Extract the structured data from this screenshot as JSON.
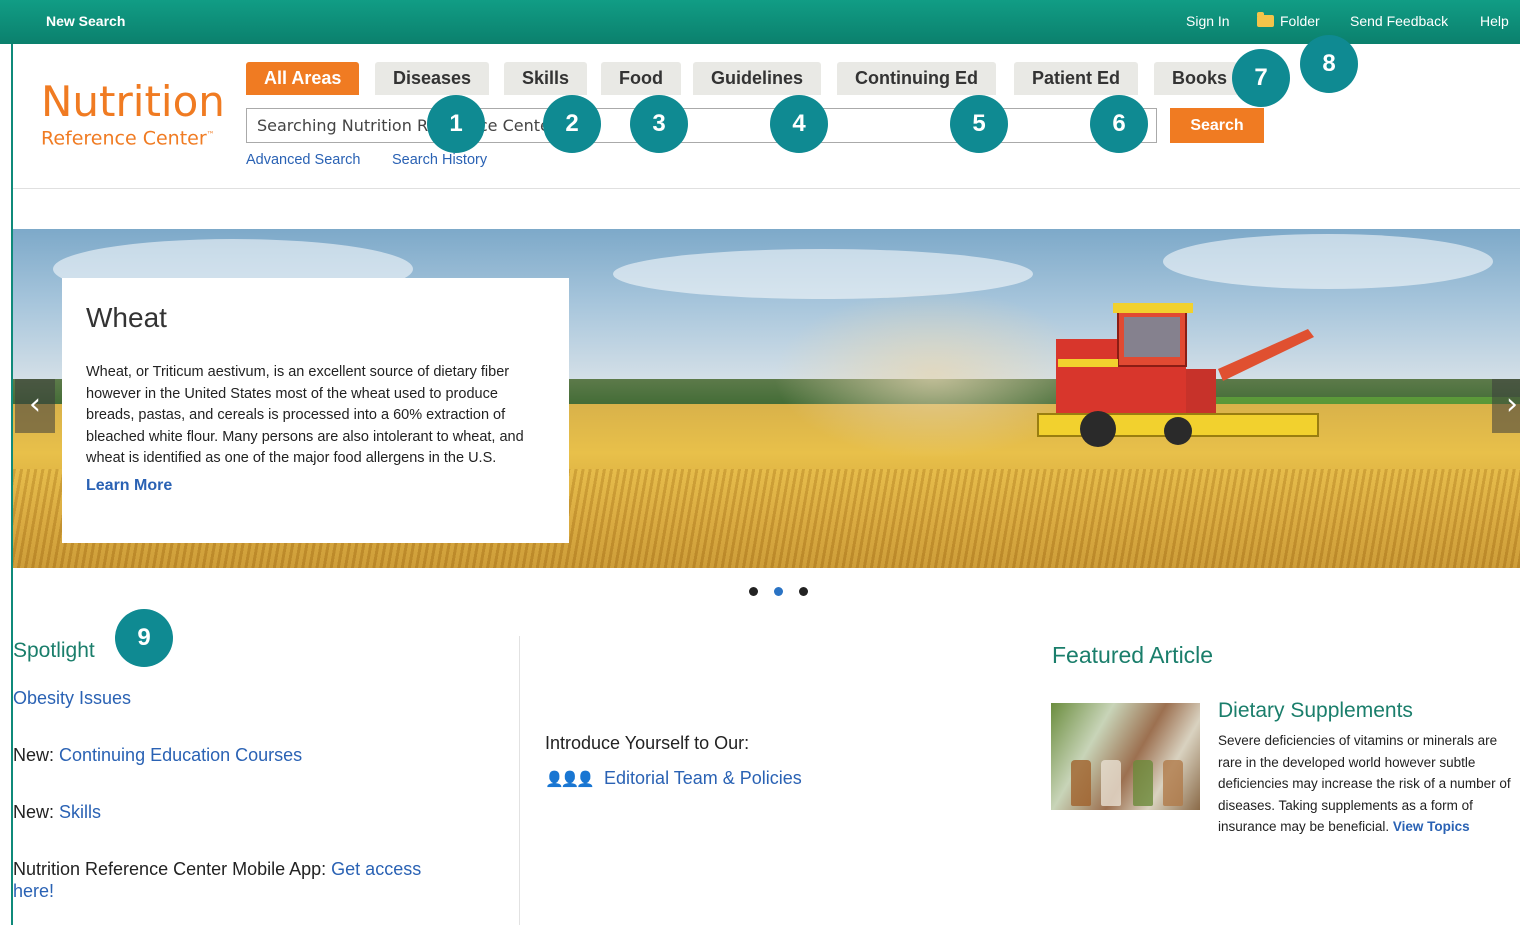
{
  "topbar": {
    "new_search": "New Search",
    "sign_in": "Sign In",
    "folder": "Folder",
    "send_feedback": "Send Feedback",
    "help": "Help"
  },
  "logo": {
    "main": "Nutrition",
    "sub": "Reference Center",
    "tm": "™"
  },
  "tabs": [
    {
      "label": "All Areas",
      "active": true
    },
    {
      "label": "Diseases"
    },
    {
      "label": "Skills"
    },
    {
      "label": "Food"
    },
    {
      "label": "Guidelines"
    },
    {
      "label": "Continuing Ed"
    },
    {
      "label": "Patient Ed"
    },
    {
      "label": "Books"
    }
  ],
  "search": {
    "value": "Searching Nutrition Reference Center",
    "button": "Search",
    "advanced": "Advanced Search",
    "history": "Search History"
  },
  "badges": [
    "1",
    "2",
    "3",
    "4",
    "5",
    "6",
    "7",
    "8",
    "9"
  ],
  "hero": {
    "title": "Wheat",
    "text": "Wheat, or Triticum aestivum, is an excellent source of dietary fiber however in the United States most of the wheat used to produce breads, pastas, and cereals is processed into a 60% extraction of bleached white flour. Many persons are also intolerant to wheat, and wheat is identified as one of the major food allergens in the U.S.",
    "learn_more": "Learn More",
    "prev": "‹",
    "next": "›",
    "slides": 3,
    "active_slide": 2
  },
  "spotlight": {
    "title": "Spotlight",
    "item1": "Obesity Issues",
    "item2_prefix": "New: ",
    "item2_link": "Continuing Education Courses",
    "item3_prefix": "New: ",
    "item3_link": "Skills",
    "item4_prefix": "Nutrition Reference Center Mobile App: ",
    "item4_link": "Get access here!"
  },
  "intro": {
    "text": "Introduce Yourself to Our:",
    "link": "Editorial Team & Policies"
  },
  "featured": {
    "title": "Featured Article",
    "headline": "Dietary Supplements",
    "body": "Severe deficiencies of vitamins or minerals are rare in the developed world however subtle deficiencies may increase the risk of a number of diseases. Taking supplements as a form of insurance may be beneficial. ",
    "link": "View Topics"
  },
  "colors": {
    "topbar": "#0f8a7a",
    "accent": "#f07b22",
    "link": "#2a62b4",
    "heading_green": "#1a7e6b",
    "badge": "#0f8a92"
  }
}
